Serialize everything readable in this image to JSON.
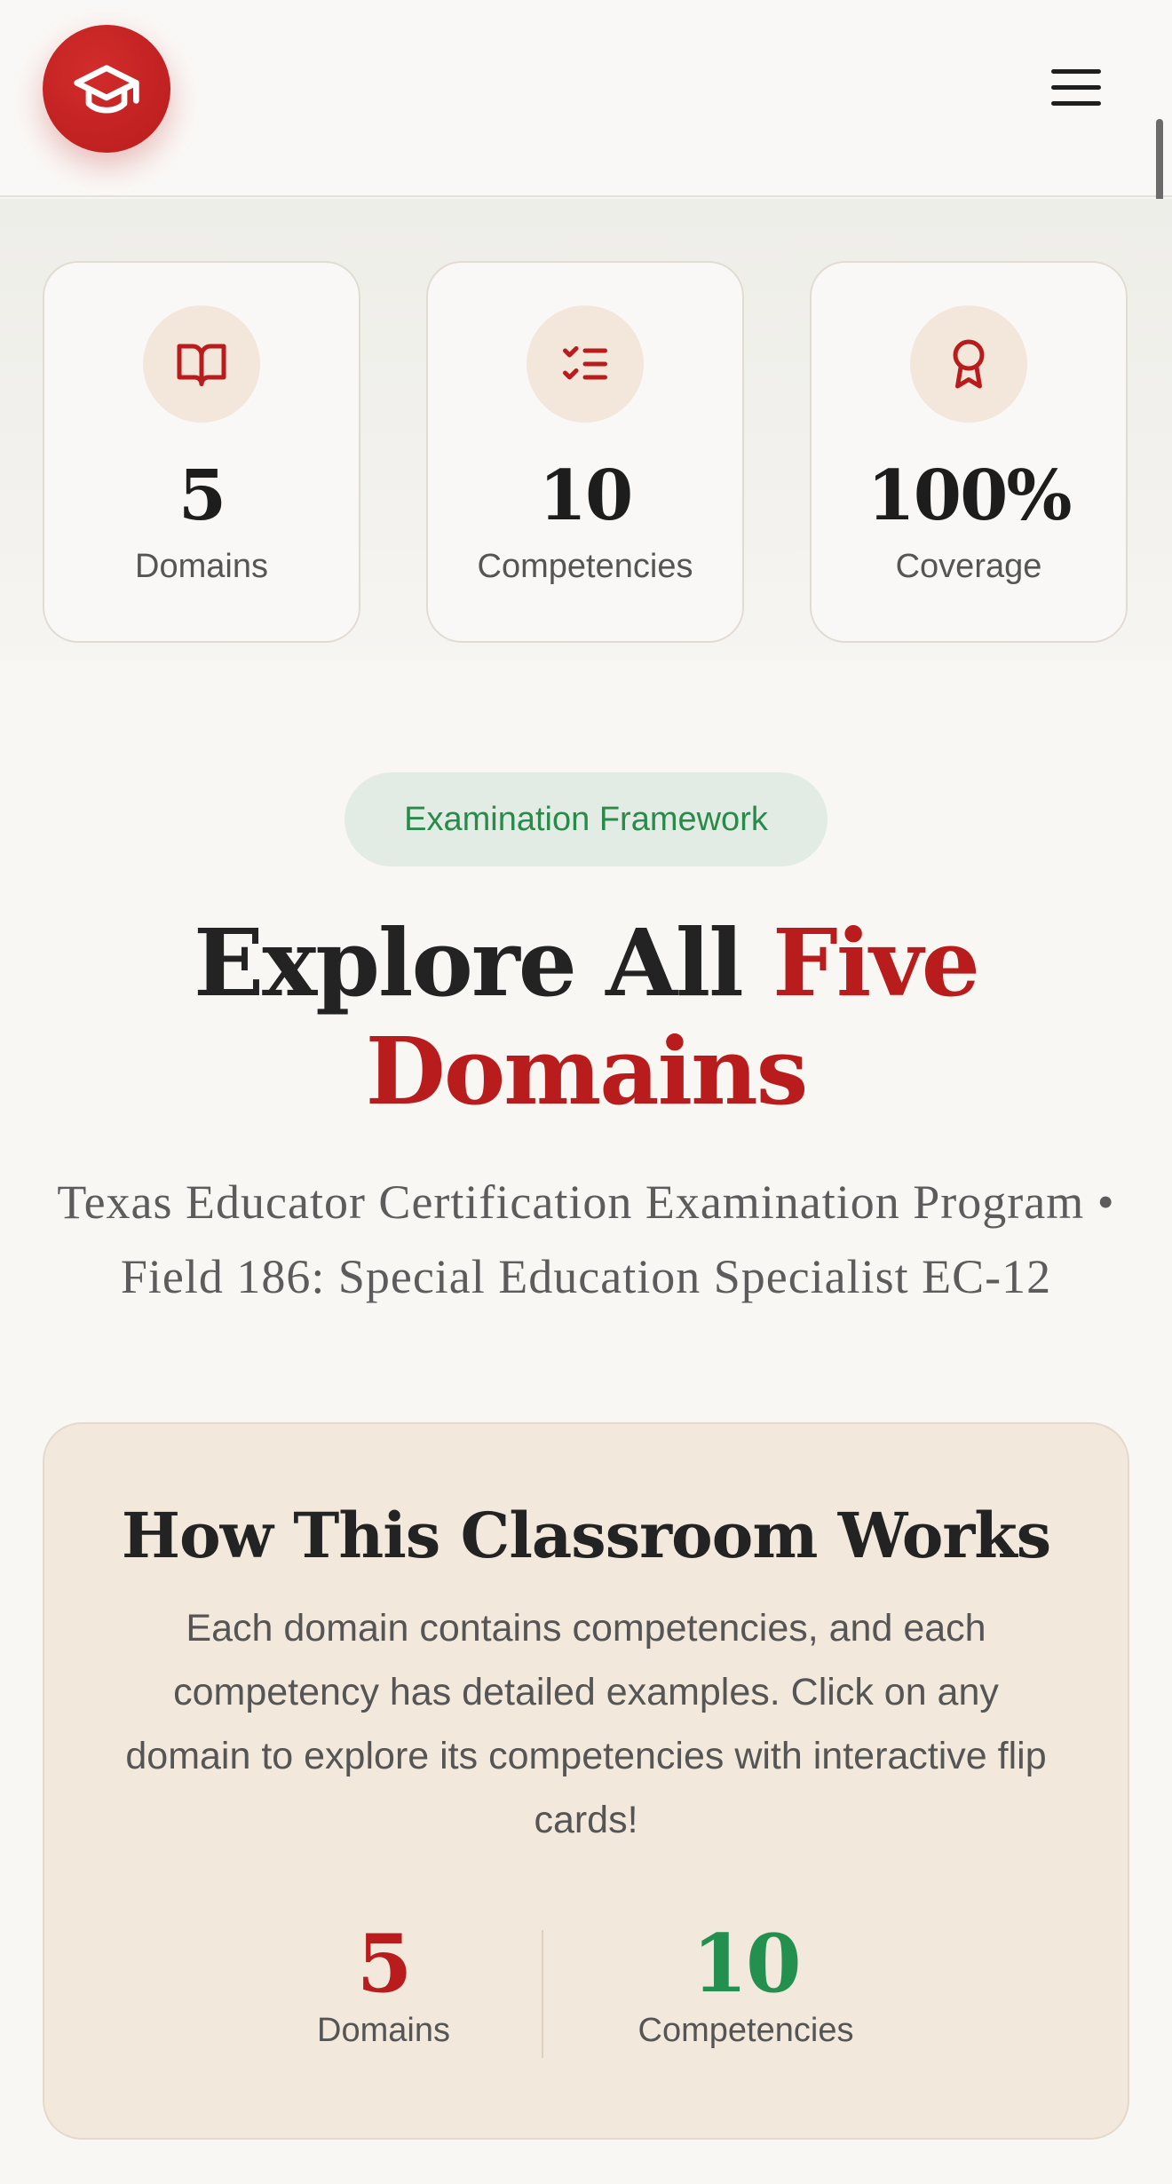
{
  "header": {
    "logo_icon": "graduation-cap-icon",
    "menu_icon": "hamburger-menu-icon"
  },
  "stats": [
    {
      "icon": "open-book-icon",
      "value": "5",
      "label": "Domains"
    },
    {
      "icon": "checklist-icon",
      "value": "10",
      "label": "Competencies"
    },
    {
      "icon": "award-ribbon-icon",
      "value": "100%",
      "label": "Coverage"
    }
  ],
  "framework": {
    "badge": "Examination Framework",
    "title_part1": "Explore All",
    "title_accent": "Five Domains",
    "subtitle": "Texas Educator Certification Examination Program • Field 186: Special Education Specialist EC-12"
  },
  "how_it_works": {
    "title": "How This Classroom Works",
    "text": "Each domain contains competencies, and each competency has detailed examples. Click on any domain to explore its competencies with interactive flip cards!",
    "stats": [
      {
        "value": "5",
        "label": "Domains",
        "color": "#b91c1c"
      },
      {
        "value": "10",
        "label": "Competencies",
        "color": "#23904f"
      }
    ]
  },
  "colors": {
    "brand_red": "#b91c1c",
    "accent_green": "#2a8a4a",
    "badge_bg": "#e3ece4",
    "card_bg": "#f2e8db"
  }
}
